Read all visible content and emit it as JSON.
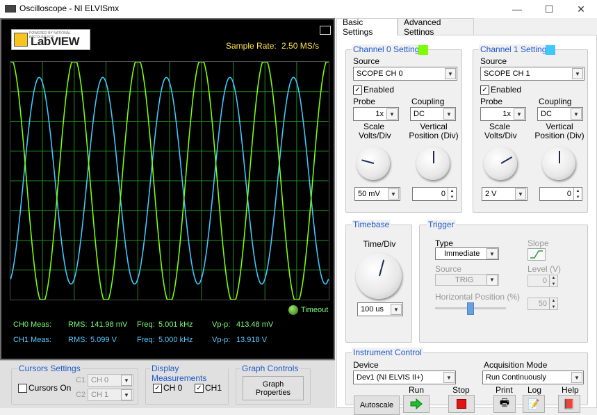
{
  "window": {
    "title": "Oscilloscope - NI ELVISmx",
    "minimize": "—",
    "maximize": "☐",
    "close": "✕"
  },
  "display": {
    "logo_top": "POWERED BY NATIONAL INSTRUMENTS",
    "logo_text": "LabVIEW",
    "sample_rate_label": "Sample Rate:",
    "sample_rate_value": "2.50 MS/s",
    "timeout_label": "Timeout",
    "ch0": {
      "label": "CH0 Meas:",
      "rms_label": "RMS:",
      "rms": "141.98 mV",
      "freq_label": "Freq:",
      "freq": "5.001 kHz",
      "vpp_label": "Vp-p:",
      "vpp": "413.48 mV"
    },
    "ch1": {
      "label": "CH1 Meas:",
      "rms_label": "RMS:",
      "rms": "5.099 V",
      "freq_label": "Freq:",
      "freq": "5.000 kHz",
      "vpp_label": "Vp-p:",
      "vpp": "13.918 V"
    }
  },
  "colors": {
    "ch0": "#7cff00",
    "ch1": "#3fc8ff",
    "grid": "#1f8f1f",
    "accent": "#1e58c8"
  },
  "traces": {
    "ch0": {
      "color": "#7cff00",
      "cycles": 5.0,
      "amplitude_div": 4.13,
      "phase": 0.0
    },
    "ch1": {
      "color": "#3fc8ff",
      "cycles": 5.0,
      "amplitude_div": 3.48,
      "phase": 0.55
    }
  },
  "cursors": {
    "group_label": "Cursors Settings",
    "cursors_on": "Cursors On",
    "c1_label": "C1",
    "c1_value": "CH 0",
    "c2_label": "C2",
    "c2_value": "CH 1"
  },
  "display_meas": {
    "group_label": "Display Measurements",
    "ch0": "CH 0",
    "ch1": "CH1"
  },
  "graph_controls": {
    "group_label": "Graph Controls",
    "button": "Graph Properties"
  },
  "tabs": {
    "basic": "Basic Settings",
    "advanced": "Advanced Settings"
  },
  "channel0": {
    "title": "Channel 0 Settings",
    "swatch": "#7cff00",
    "source_label": "Source",
    "source": "SCOPE CH 0",
    "enabled": "Enabled",
    "probe_label": "Probe",
    "probe": "1x",
    "coupling_label": "Coupling",
    "coupling": "DC",
    "scale_label": "Scale Volts/Div",
    "scale": "50 mV",
    "vpos_label": "Vertical Position (Div)",
    "vpos": "0"
  },
  "channel1": {
    "title": "Channel 1 Settings",
    "swatch": "#3fc8ff",
    "source_label": "Source",
    "source": "SCOPE CH 1",
    "enabled": "Enabled",
    "probe_label": "Probe",
    "probe": "1x",
    "coupling_label": "Coupling",
    "coupling": "DC",
    "scale_label": "Scale Volts/Div",
    "scale": "2 V",
    "vpos_label": "Vertical Position (Div)",
    "vpos": "0"
  },
  "timebase": {
    "title": "Timebase",
    "label": "Time/Div",
    "value": "100 us"
  },
  "trigger": {
    "title": "Trigger",
    "type_label": "Type",
    "type": "Immediate",
    "slope_label": "Slope",
    "source_label": "Source",
    "source": "TRIG",
    "level_label": "Level (V)",
    "level": "0",
    "hpos_label": "Horizontal Position (%)",
    "hpos": "50"
  },
  "instrument": {
    "title": "Instrument Control",
    "device_label": "Device",
    "device": "Dev1 (NI ELVIS II+)",
    "acq_label": "Acquisition Mode",
    "acq": "Run Continuously",
    "autoscale": "Autoscale",
    "run": "Run",
    "stop": "Stop",
    "print": "Print",
    "log": "Log",
    "help": "Help"
  }
}
